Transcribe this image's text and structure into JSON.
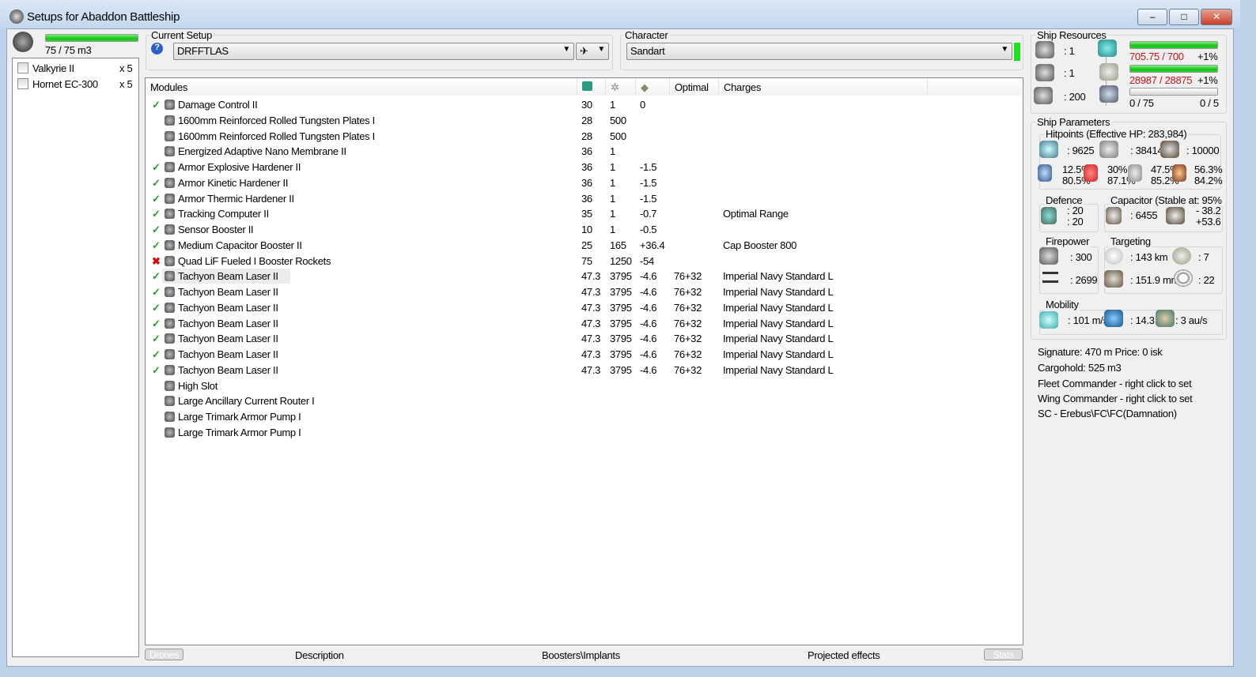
{
  "window": {
    "title": "Setups for Abaddon Battleship",
    "minimize": "‒",
    "maximize": "□",
    "close": "✕"
  },
  "drone_bay": {
    "capacity": "75 / 75 m3",
    "fill": 1.0,
    "drones": [
      {
        "name": "Valkyrie II",
        "qty": "x 5"
      },
      {
        "name": "Hornet EC-300",
        "qty": "x 5"
      }
    ]
  },
  "setup": {
    "label": "Current Setup",
    "value": "DRFFTLAS",
    "help": "?"
  },
  "character": {
    "label": "Character",
    "value": "Sandart"
  },
  "modules": {
    "headers": {
      "name": "Modules",
      "optimal": "Optimal",
      "charges": "Charges"
    },
    "rows": [
      {
        "status": "ok",
        "name": "Damage Control II",
        "cpu": "30",
        "pg": "1",
        "cap": "0",
        "opt": "",
        "charge": ""
      },
      {
        "status": "",
        "name": "1600mm Reinforced Rolled Tungsten Plates I",
        "cpu": "28",
        "pg": "500",
        "cap": "",
        "opt": "",
        "charge": ""
      },
      {
        "status": "",
        "name": "1600mm Reinforced Rolled Tungsten Plates I",
        "cpu": "28",
        "pg": "500",
        "cap": "",
        "opt": "",
        "charge": ""
      },
      {
        "status": "",
        "name": "Energized Adaptive Nano Membrane II",
        "cpu": "36",
        "pg": "1",
        "cap": "",
        "opt": "",
        "charge": ""
      },
      {
        "status": "ok",
        "name": "Armor Explosive Hardener II",
        "cpu": "36",
        "pg": "1",
        "cap": "-1.5",
        "opt": "",
        "charge": ""
      },
      {
        "status": "ok",
        "name": "Armor Kinetic Hardener II",
        "cpu": "36",
        "pg": "1",
        "cap": "-1.5",
        "opt": "",
        "charge": ""
      },
      {
        "status": "ok",
        "name": "Armor Thermic Hardener II",
        "cpu": "36",
        "pg": "1",
        "cap": "-1.5",
        "opt": "",
        "charge": ""
      },
      {
        "status": "ok",
        "name": "Tracking Computer II",
        "cpu": "35",
        "pg": "1",
        "cap": "-0.7",
        "opt": "",
        "charge": "Optimal Range"
      },
      {
        "status": "ok",
        "name": "Sensor Booster II",
        "cpu": "10",
        "pg": "1",
        "cap": "-0.5",
        "opt": "",
        "charge": ""
      },
      {
        "status": "ok",
        "name": "Medium Capacitor Booster II",
        "cpu": "25",
        "pg": "165",
        "cap": "+36.4",
        "opt": "",
        "charge": "Cap Booster 800"
      },
      {
        "status": "bad",
        "name": "Quad LiF Fueled I Booster Rockets",
        "cpu": "75",
        "pg": "1250",
        "cap": "-54",
        "opt": "",
        "charge": ""
      },
      {
        "status": "ok",
        "name": "Tachyon Beam Laser II",
        "cpu": "47.3",
        "pg": "3795",
        "cap": "-4.6",
        "opt": "76+32",
        "charge": "Imperial Navy Standard L"
      },
      {
        "status": "ok",
        "name": "Tachyon Beam Laser II",
        "cpu": "47.3",
        "pg": "3795",
        "cap": "-4.6",
        "opt": "76+32",
        "charge": "Imperial Navy Standard L"
      },
      {
        "status": "ok",
        "name": "Tachyon Beam Laser II",
        "cpu": "47.3",
        "pg": "3795",
        "cap": "-4.6",
        "opt": "76+32",
        "charge": "Imperial Navy Standard L"
      },
      {
        "status": "ok",
        "name": "Tachyon Beam Laser II",
        "cpu": "47.3",
        "pg": "3795",
        "cap": "-4.6",
        "opt": "76+32",
        "charge": "Imperial Navy Standard L"
      },
      {
        "status": "ok",
        "name": "Tachyon Beam Laser II",
        "cpu": "47.3",
        "pg": "3795",
        "cap": "-4.6",
        "opt": "76+32",
        "charge": "Imperial Navy Standard L"
      },
      {
        "status": "ok",
        "name": "Tachyon Beam Laser II",
        "cpu": "47.3",
        "pg": "3795",
        "cap": "-4.6",
        "opt": "76+32",
        "charge": "Imperial Navy Standard L"
      },
      {
        "status": "ok",
        "name": "Tachyon Beam Laser II",
        "cpu": "47.3",
        "pg": "3795",
        "cap": "-4.6",
        "opt": "76+32",
        "charge": "Imperial Navy Standard L"
      },
      {
        "status": "",
        "name": "High Slot",
        "cpu": "",
        "pg": "",
        "cap": "",
        "opt": "",
        "charge": ""
      },
      {
        "status": "",
        "name": "Large Ancillary Current Router I",
        "cpu": "",
        "pg": "",
        "cap": "",
        "opt": "",
        "charge": ""
      },
      {
        "status": "",
        "name": "Large Trimark Armor Pump I",
        "cpu": "",
        "pg": "",
        "cap": "",
        "opt": "",
        "charge": ""
      },
      {
        "status": "",
        "name": "Large Trimark Armor Pump I",
        "cpu": "",
        "pg": "",
        "cap": "",
        "opt": "",
        "charge": ""
      }
    ]
  },
  "tabs": [
    "Drones",
    "Description",
    "Boosters\\Implants",
    "Projected effects",
    "Stats"
  ],
  "resources": {
    "label": "Ship Resources",
    "turrets": ": 1",
    "launchers": ": 1",
    "drone_bw": ": 200",
    "cpu": "705.75 / 700",
    "cpu_pct": "+1%",
    "cpu_fill": 1.0,
    "pg": "28987 / 28875",
    "pg_pct": "+1%",
    "pg_fill": 1.0,
    "calib": "0 / 75",
    "calib_slots": "0 / 5",
    "calib_fill": 0
  },
  "params": {
    "label": "Ship Parameters",
    "hp_label": "Hitpoints (Effective HP: 283,984)",
    "shield": ": 9625",
    "armor": ": 38414",
    "hull": ": 10000",
    "res": [
      [
        "12.5%",
        "80.5%"
      ],
      [
        "30%",
        "87.1%"
      ],
      [
        "47.5%",
        "85.2%"
      ],
      [
        "56.3%",
        "84.2%"
      ]
    ],
    "defence_label": "Defence",
    "def1": ": 20",
    "def2": ": 20",
    "cap_label": "Capacitor (Stable at: 95%",
    "cap": ": 6455",
    "cap_use": "- 38.2",
    "cap_regen": "+53.6",
    "fire_label": "Firepower",
    "volley": ": 300",
    "dps": ": 2699",
    "target_label": "Targeting",
    "range": ": 143 km",
    "max_targets": ": 7",
    "scan": ": 151.9 mm",
    "sig_res": ": 22",
    "mob_label": "Mobility",
    "speed": ": 101 m/s",
    "agility": ": 14.3",
    "warp": ": 3 au/s"
  },
  "info": [
    "Signature: 470 m Price: 0 isk",
    "Cargohold: 525 m3",
    "Fleet Commander - right click to set",
    "Wing Commander - right click to set",
    "SC - Erebus\\FC\\FC(Damnation)"
  ]
}
